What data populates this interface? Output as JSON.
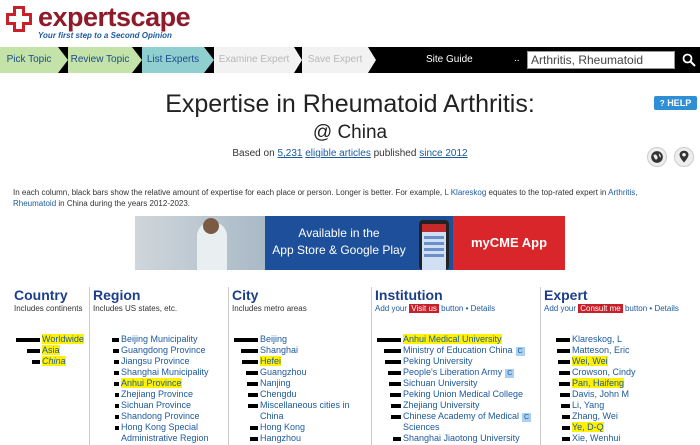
{
  "header": {
    "logo_text": "expertscape",
    "tagline": "Your first step to a Second Opinion"
  },
  "nav": {
    "steps": [
      "Pick Topic",
      "Review Topic",
      "List Experts",
      "Examine Expert",
      "Save Expert"
    ],
    "site_guide": "Site Guide",
    "dots": "..",
    "search_value": "Arthritis, Rheumatoid"
  },
  "title": {
    "line1": "Expertise in Rheumatoid Arthritis:",
    "line2": "@ China",
    "based_pre": "Based on ",
    "based_count": "5,231",
    "based_link": "eligible articles",
    "based_mid": " published ",
    "based_since": "since 2012",
    "help": "HELP"
  },
  "description": {
    "text1": "In each column, black bars show the relative amount of expertise for each place or person. Longer is better. For example, ",
    "link1": "L Klareskog",
    "text2": " equates to the top-rated expert in ",
    "link2": "Arthritis,",
    "link3": "Rheumatoid",
    "text3": " in China during the years 2012-2023."
  },
  "banner": {
    "line1": "Available in the",
    "line2": "App Store & Google Play",
    "cta": "myCME App"
  },
  "columns": {
    "country": {
      "title": "Country",
      "subtitle": "Includes continents",
      "items": [
        {
          "label": "Worldwide",
          "bar": 1.0,
          "hl": true,
          "italic": false
        },
        {
          "label": "Asia",
          "bar": 0.55,
          "hl": true,
          "italic": false
        },
        {
          "label": "China",
          "bar": 0.35,
          "hl": true,
          "italic": true
        }
      ]
    },
    "region": {
      "title": "Region",
      "subtitle": "Includes US states, etc.",
      "items": [
        {
          "label": "Beijing Municipality",
          "bar": 0.3,
          "hl": false
        },
        {
          "label": "Guangdong Province",
          "bar": 0.25,
          "hl": false
        },
        {
          "label": "Jiangsu Province",
          "bar": 0.2,
          "hl": false
        },
        {
          "label": "Shanghai Municipality",
          "bar": 0.2,
          "hl": false
        },
        {
          "label": "Anhui Province",
          "bar": 0.2,
          "hl": true
        },
        {
          "label": "Zhejiang Province",
          "bar": 0.15,
          "hl": false
        },
        {
          "label": "Sichuan Province",
          "bar": 0.15,
          "hl": false
        },
        {
          "label": "Shandong Province",
          "bar": 0.15,
          "hl": false
        },
        {
          "label": "Hong Kong Special",
          "label2": "Administrative Region",
          "bar": 0.15,
          "hl": false
        }
      ]
    },
    "city": {
      "title": "City",
      "subtitle": "Includes metro areas",
      "items": [
        {
          "label": "Beijing",
          "bar": 1.0,
          "hl": false
        },
        {
          "label": "Shanghai",
          "bar": 0.7,
          "hl": false
        },
        {
          "label": "Hefei",
          "bar": 0.65,
          "hl": true
        },
        {
          "label": "Guangzhou",
          "bar": 0.5,
          "hl": false
        },
        {
          "label": "Nanjing",
          "bar": 0.45,
          "hl": false
        },
        {
          "label": "Chengdu",
          "bar": 0.4,
          "hl": false
        },
        {
          "label": "Miscellaneous cities in",
          "label2": "China",
          "bar": 0.4,
          "hl": false
        },
        {
          "label": "Hong Kong",
          "bar": 0.35,
          "hl": false
        },
        {
          "label": "Hangzhou",
          "bar": 0.35,
          "hl": false
        }
      ]
    },
    "institution": {
      "title": "Institution",
      "sub_pre": "Add your ",
      "sub_tag": "Visit us",
      "sub_mid": " button • ",
      "sub_link": "Details",
      "items": [
        {
          "label": "Anhui Medical University",
          "bar": 1.0,
          "hl": true,
          "badge": ""
        },
        {
          "label": "Ministry of Education China",
          "bar": 0.7,
          "hl": false,
          "badge": "C"
        },
        {
          "label": "Peking University",
          "bar": 0.65,
          "hl": false,
          "badge": ""
        },
        {
          "label": "People's Liberation Army",
          "bar": 0.55,
          "hl": false,
          "badge": "C"
        },
        {
          "label": "Sichuan University",
          "bar": 0.5,
          "hl": false,
          "badge": ""
        },
        {
          "label": "Peking Union Medical College",
          "bar": 0.45,
          "hl": false,
          "badge": ""
        },
        {
          "label": "Zhejiang University",
          "bar": 0.4,
          "hl": false,
          "badge": ""
        },
        {
          "label": "Chinese Academy of Medical",
          "label2": "Sciences",
          "bar": 0.4,
          "hl": false,
          "badge": "C"
        },
        {
          "label": "Shanghai Jiaotong University",
          "bar": 0.35,
          "hl": false,
          "badge": ""
        }
      ]
    },
    "expert": {
      "title": "Expert",
      "sub_pre": "Add your ",
      "sub_tag": "Consult me",
      "sub_mid": " button • ",
      "sub_link": "Details",
      "items": [
        {
          "label": "Klareskog, L",
          "bar": 1.0,
          "hl": false
        },
        {
          "label": "Matteson, Eric",
          "bar": 0.9,
          "hl": false
        },
        {
          "label": "Wei, Wei",
          "bar": 0.85,
          "hl": true
        },
        {
          "label": "Crowson, Cindy",
          "bar": 0.8,
          "hl": false
        },
        {
          "label": "Pan, Haifeng",
          "bar": 0.75,
          "hl": true
        },
        {
          "label": "Davis, John M",
          "bar": 0.7,
          "hl": false
        },
        {
          "label": "Li, Yang",
          "bar": 0.65,
          "hl": false
        },
        {
          "label": "Zhang, Wei",
          "bar": 0.6,
          "hl": false
        },
        {
          "label": "Ye, D-Q",
          "bar": 0.6,
          "hl": true
        },
        {
          "label": "Xie, Wenhui",
          "bar": 0.55,
          "hl": false
        }
      ]
    }
  },
  "colors": {
    "brand_red": "#8f1a2a",
    "brand_blue": "#1c5aa0",
    "heading_blue": "#1c3f8a",
    "highlight": "#fff100"
  }
}
